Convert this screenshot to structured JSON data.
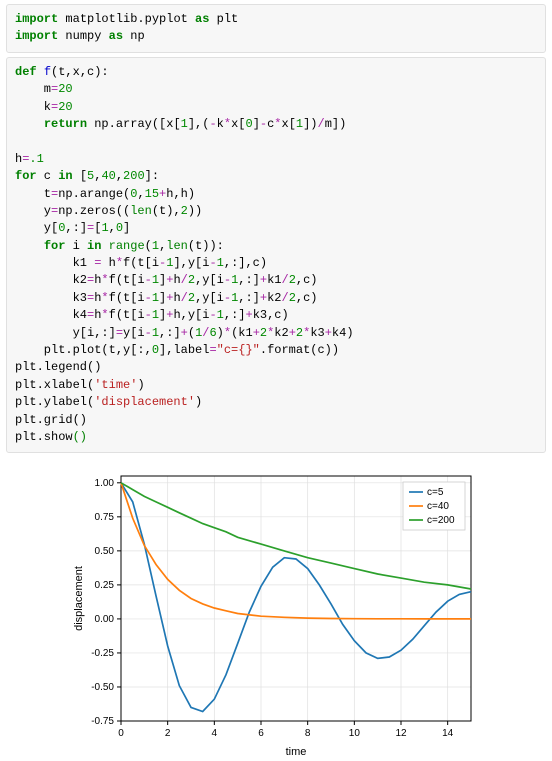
{
  "code": {
    "block1": [
      {
        "segs": [
          {
            "t": "import",
            "c": "kw"
          },
          {
            "t": " matplotlib.pyplot "
          },
          {
            "t": "as",
            "c": "kw"
          },
          {
            "t": " plt"
          }
        ]
      },
      {
        "segs": [
          {
            "t": "import",
            "c": "kw"
          },
          {
            "t": " numpy "
          },
          {
            "t": "as",
            "c": "kw"
          },
          {
            "t": " np"
          }
        ]
      }
    ],
    "block2": [
      {
        "segs": [
          {
            "t": "def",
            "c": "kw"
          },
          {
            "t": " "
          },
          {
            "t": "f",
            "c": "fn"
          },
          {
            "t": "(t,x,c):"
          }
        ]
      },
      {
        "segs": [
          {
            "t": "    m"
          },
          {
            "t": "=",
            "c": "op"
          },
          {
            "t": "20",
            "c": "num"
          }
        ]
      },
      {
        "segs": [
          {
            "t": "    k"
          },
          {
            "t": "=",
            "c": "op"
          },
          {
            "t": "20",
            "c": "num"
          }
        ]
      },
      {
        "segs": [
          {
            "t": "    "
          },
          {
            "t": "return",
            "c": "kw"
          },
          {
            "t": " np.array([x["
          },
          {
            "t": "1",
            "c": "num"
          },
          {
            "t": "],("
          },
          {
            "t": "-",
            "c": "op"
          },
          {
            "t": "k"
          },
          {
            "t": "*",
            "c": "op"
          },
          {
            "t": "x["
          },
          {
            "t": "0",
            "c": "num"
          },
          {
            "t": "]"
          },
          {
            "t": "-",
            "c": "op"
          },
          {
            "t": "c"
          },
          {
            "t": "*",
            "c": "op"
          },
          {
            "t": "x["
          },
          {
            "t": "1",
            "c": "num"
          },
          {
            "t": "])"
          },
          {
            "t": "/",
            "c": "op"
          },
          {
            "t": "m])"
          }
        ]
      },
      {
        "segs": [
          {
            "t": " "
          }
        ]
      },
      {
        "segs": [
          {
            "t": "h"
          },
          {
            "t": "=",
            "c": "op"
          },
          {
            "t": ".1",
            "c": "num"
          }
        ]
      },
      {
        "segs": [
          {
            "t": "for",
            "c": "kw"
          },
          {
            "t": " c "
          },
          {
            "t": "in",
            "c": "kw"
          },
          {
            "t": " ["
          },
          {
            "t": "5",
            "c": "num"
          },
          {
            "t": ","
          },
          {
            "t": "40",
            "c": "num"
          },
          {
            "t": ","
          },
          {
            "t": "200",
            "c": "num"
          },
          {
            "t": "]:"
          }
        ]
      },
      {
        "segs": [
          {
            "t": "    t"
          },
          {
            "t": "=",
            "c": "op"
          },
          {
            "t": "np.arange("
          },
          {
            "t": "0",
            "c": "num"
          },
          {
            "t": ","
          },
          {
            "t": "15",
            "c": "num"
          },
          {
            "t": "+",
            "c": "op"
          },
          {
            "t": "h,h)"
          }
        ]
      },
      {
        "segs": [
          {
            "t": "    y"
          },
          {
            "t": "=",
            "c": "op"
          },
          {
            "t": "np.zeros(("
          },
          {
            "t": "len",
            "c": "builtin"
          },
          {
            "t": "(t),"
          },
          {
            "t": "2",
            "c": "num"
          },
          {
            "t": "))"
          }
        ]
      },
      {
        "segs": [
          {
            "t": "    y["
          },
          {
            "t": "0",
            "c": "num"
          },
          {
            "t": ",:]"
          },
          {
            "t": "=",
            "c": "op"
          },
          {
            "t": "["
          },
          {
            "t": "1",
            "c": "num"
          },
          {
            "t": ","
          },
          {
            "t": "0",
            "c": "num"
          },
          {
            "t": "]"
          }
        ]
      },
      {
        "segs": [
          {
            "t": "    "
          },
          {
            "t": "for",
            "c": "kw"
          },
          {
            "t": " i "
          },
          {
            "t": "in",
            "c": "kw"
          },
          {
            "t": " "
          },
          {
            "t": "range",
            "c": "builtin"
          },
          {
            "t": "("
          },
          {
            "t": "1",
            "c": "num"
          },
          {
            "t": ","
          },
          {
            "t": "len",
            "c": "builtin"
          },
          {
            "t": "(t)):"
          }
        ]
      },
      {
        "segs": [
          {
            "t": "        k1 "
          },
          {
            "t": "=",
            "c": "op"
          },
          {
            "t": " h"
          },
          {
            "t": "*",
            "c": "op"
          },
          {
            "t": "f(t[i"
          },
          {
            "t": "-",
            "c": "op"
          },
          {
            "t": "1",
            "c": "num"
          },
          {
            "t": "],y[i"
          },
          {
            "t": "-",
            "c": "op"
          },
          {
            "t": "1",
            "c": "num"
          },
          {
            "t": ",:],c)"
          }
        ]
      },
      {
        "segs": [
          {
            "t": "        k2"
          },
          {
            "t": "=",
            "c": "op"
          },
          {
            "t": "h"
          },
          {
            "t": "*",
            "c": "op"
          },
          {
            "t": "f(t[i"
          },
          {
            "t": "-",
            "c": "op"
          },
          {
            "t": "1",
            "c": "num"
          },
          {
            "t": "]"
          },
          {
            "t": "+",
            "c": "op"
          },
          {
            "t": "h"
          },
          {
            "t": "/",
            "c": "op"
          },
          {
            "t": "2",
            "c": "num"
          },
          {
            "t": ",y[i"
          },
          {
            "t": "-",
            "c": "op"
          },
          {
            "t": "1",
            "c": "num"
          },
          {
            "t": ",:]"
          },
          {
            "t": "+",
            "c": "op"
          },
          {
            "t": "k1"
          },
          {
            "t": "/",
            "c": "op"
          },
          {
            "t": "2",
            "c": "num"
          },
          {
            "t": ",c)"
          }
        ]
      },
      {
        "segs": [
          {
            "t": "        k3"
          },
          {
            "t": "=",
            "c": "op"
          },
          {
            "t": "h"
          },
          {
            "t": "*",
            "c": "op"
          },
          {
            "t": "f(t[i"
          },
          {
            "t": "-",
            "c": "op"
          },
          {
            "t": "1",
            "c": "num"
          },
          {
            "t": "]"
          },
          {
            "t": "+",
            "c": "op"
          },
          {
            "t": "h"
          },
          {
            "t": "/",
            "c": "op"
          },
          {
            "t": "2",
            "c": "num"
          },
          {
            "t": ",y[i"
          },
          {
            "t": "-",
            "c": "op"
          },
          {
            "t": "1",
            "c": "num"
          },
          {
            "t": ",:]"
          },
          {
            "t": "+",
            "c": "op"
          },
          {
            "t": "k2"
          },
          {
            "t": "/",
            "c": "op"
          },
          {
            "t": "2",
            "c": "num"
          },
          {
            "t": ",c)"
          }
        ]
      },
      {
        "segs": [
          {
            "t": "        k4"
          },
          {
            "t": "=",
            "c": "op"
          },
          {
            "t": "h"
          },
          {
            "t": "*",
            "c": "op"
          },
          {
            "t": "f(t[i"
          },
          {
            "t": "-",
            "c": "op"
          },
          {
            "t": "1",
            "c": "num"
          },
          {
            "t": "]"
          },
          {
            "t": "+",
            "c": "op"
          },
          {
            "t": "h,y[i"
          },
          {
            "t": "-",
            "c": "op"
          },
          {
            "t": "1",
            "c": "num"
          },
          {
            "t": ",:]"
          },
          {
            "t": "+",
            "c": "op"
          },
          {
            "t": "k3,c)"
          }
        ]
      },
      {
        "segs": [
          {
            "t": "        y[i,:]"
          },
          {
            "t": "=",
            "c": "op"
          },
          {
            "t": "y[i"
          },
          {
            "t": "-",
            "c": "op"
          },
          {
            "t": "1",
            "c": "num"
          },
          {
            "t": ",:]"
          },
          {
            "t": "+",
            "c": "op"
          },
          {
            "t": "("
          },
          {
            "t": "1",
            "c": "num"
          },
          {
            "t": "/",
            "c": "op"
          },
          {
            "t": "6",
            "c": "num"
          },
          {
            "t": ")"
          },
          {
            "t": "*",
            "c": "op"
          },
          {
            "t": "(k1"
          },
          {
            "t": "+",
            "c": "op"
          },
          {
            "t": "2",
            "c": "num"
          },
          {
            "t": "*",
            "c": "op"
          },
          {
            "t": "k2"
          },
          {
            "t": "+",
            "c": "op"
          },
          {
            "t": "2",
            "c": "num"
          },
          {
            "t": "*",
            "c": "op"
          },
          {
            "t": "k3"
          },
          {
            "t": "+",
            "c": "op"
          },
          {
            "t": "k4)"
          }
        ]
      },
      {
        "segs": [
          {
            "t": "    plt.plot(t,y[:,"
          },
          {
            "t": "0",
            "c": "num"
          },
          {
            "t": "],label"
          },
          {
            "t": "=",
            "c": "op"
          },
          {
            "t": "\"c={}\"",
            "c": "str"
          },
          {
            "t": ".format(c))"
          }
        ]
      },
      {
        "segs": [
          {
            "t": "plt.legend()"
          }
        ]
      },
      {
        "segs": [
          {
            "t": "plt.xlabel("
          },
          {
            "t": "'time'",
            "c": "str"
          },
          {
            "t": ")"
          }
        ]
      },
      {
        "segs": [
          {
            "t": "plt.ylabel("
          },
          {
            "t": "'displacement'",
            "c": "str"
          },
          {
            "t": ")"
          }
        ]
      },
      {
        "segs": [
          {
            "t": "plt.grid()"
          }
        ]
      },
      {
        "segs": [
          {
            "t": "plt.show"
          },
          {
            "t": "()",
            "c": "builtin"
          }
        ]
      }
    ]
  },
  "chart_data": {
    "type": "line",
    "xlabel": "time",
    "ylabel": "displacement",
    "xlim": [
      0,
      15
    ],
    "ylim": [
      -0.75,
      1.05
    ],
    "xticks": [
      0,
      2,
      4,
      6,
      8,
      10,
      12,
      14
    ],
    "yticks": [
      -0.75,
      -0.5,
      -0.25,
      0.0,
      0.25,
      0.5,
      0.75,
      1.0
    ],
    "legend_pos": "upper-right",
    "series": [
      {
        "name": "c=5",
        "color": "#1f77b4",
        "x": [
          0,
          0.5,
          1,
          1.5,
          2,
          2.5,
          3,
          3.5,
          4,
          4.5,
          5,
          5.5,
          6,
          6.5,
          7,
          7.5,
          8,
          8.5,
          9,
          9.5,
          10,
          10.5,
          11,
          11.5,
          12,
          12.5,
          13,
          13.5,
          14,
          14.5,
          15
        ],
        "y": [
          1.0,
          0.86,
          0.55,
          0.17,
          -0.2,
          -0.49,
          -0.65,
          -0.68,
          -0.59,
          -0.41,
          -0.18,
          0.05,
          0.24,
          0.38,
          0.45,
          0.44,
          0.37,
          0.25,
          0.11,
          -0.04,
          -0.16,
          -0.25,
          -0.29,
          -0.28,
          -0.23,
          -0.15,
          -0.05,
          0.05,
          0.13,
          0.18,
          0.2
        ]
      },
      {
        "name": "c=40",
        "color": "#ff7f0e",
        "x": [
          0,
          0.5,
          1,
          1.5,
          2,
          2.5,
          3,
          3.5,
          4,
          4.5,
          5,
          6,
          7,
          8,
          9,
          10,
          11,
          12,
          13,
          14,
          15
        ],
        "y": [
          1.0,
          0.74,
          0.54,
          0.4,
          0.29,
          0.21,
          0.15,
          0.11,
          0.08,
          0.06,
          0.04,
          0.02,
          0.012,
          0.006,
          0.003,
          0.0017,
          0.0009,
          0.0005,
          0.0003,
          0.00014,
          7e-05
        ]
      },
      {
        "name": "c=200",
        "color": "#2ca02c",
        "x": [
          0,
          0.5,
          1,
          1.5,
          2,
          2.5,
          3,
          3.5,
          4,
          4.5,
          5,
          6,
          7,
          8,
          9,
          10,
          11,
          12,
          13,
          14,
          15
        ],
        "y": [
          1.0,
          0.95,
          0.9,
          0.86,
          0.82,
          0.78,
          0.74,
          0.7,
          0.67,
          0.64,
          0.6,
          0.55,
          0.5,
          0.45,
          0.41,
          0.37,
          0.33,
          0.3,
          0.27,
          0.25,
          0.22
        ]
      }
    ]
  }
}
